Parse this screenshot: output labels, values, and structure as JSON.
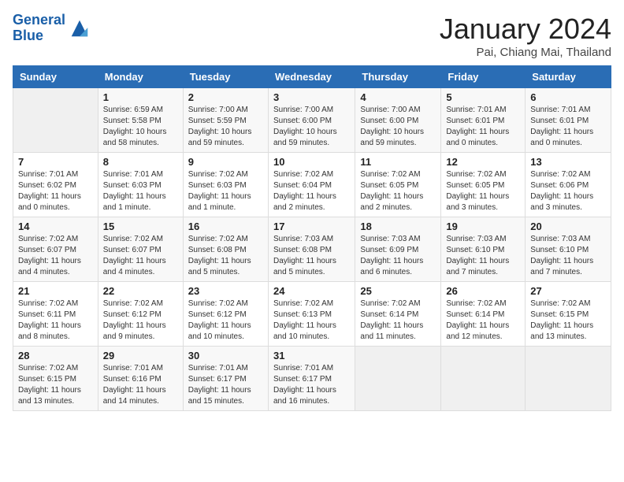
{
  "header": {
    "logo_line1": "General",
    "logo_line2": "Blue",
    "month": "January 2024",
    "location": "Pai, Chiang Mai, Thailand"
  },
  "days_of_week": [
    "Sunday",
    "Monday",
    "Tuesday",
    "Wednesday",
    "Thursday",
    "Friday",
    "Saturday"
  ],
  "weeks": [
    [
      {
        "day": "",
        "info": ""
      },
      {
        "day": "1",
        "info": "Sunrise: 6:59 AM\nSunset: 5:58 PM\nDaylight: 10 hours\nand 58 minutes."
      },
      {
        "day": "2",
        "info": "Sunrise: 7:00 AM\nSunset: 5:59 PM\nDaylight: 10 hours\nand 59 minutes."
      },
      {
        "day": "3",
        "info": "Sunrise: 7:00 AM\nSunset: 6:00 PM\nDaylight: 10 hours\nand 59 minutes."
      },
      {
        "day": "4",
        "info": "Sunrise: 7:00 AM\nSunset: 6:00 PM\nDaylight: 10 hours\nand 59 minutes."
      },
      {
        "day": "5",
        "info": "Sunrise: 7:01 AM\nSunset: 6:01 PM\nDaylight: 11 hours\nand 0 minutes."
      },
      {
        "day": "6",
        "info": "Sunrise: 7:01 AM\nSunset: 6:01 PM\nDaylight: 11 hours\nand 0 minutes."
      }
    ],
    [
      {
        "day": "7",
        "info": "Sunrise: 7:01 AM\nSunset: 6:02 PM\nDaylight: 11 hours\nand 0 minutes."
      },
      {
        "day": "8",
        "info": "Sunrise: 7:01 AM\nSunset: 6:03 PM\nDaylight: 11 hours\nand 1 minute."
      },
      {
        "day": "9",
        "info": "Sunrise: 7:02 AM\nSunset: 6:03 PM\nDaylight: 11 hours\nand 1 minute."
      },
      {
        "day": "10",
        "info": "Sunrise: 7:02 AM\nSunset: 6:04 PM\nDaylight: 11 hours\nand 2 minutes."
      },
      {
        "day": "11",
        "info": "Sunrise: 7:02 AM\nSunset: 6:05 PM\nDaylight: 11 hours\nand 2 minutes."
      },
      {
        "day": "12",
        "info": "Sunrise: 7:02 AM\nSunset: 6:05 PM\nDaylight: 11 hours\nand 3 minutes."
      },
      {
        "day": "13",
        "info": "Sunrise: 7:02 AM\nSunset: 6:06 PM\nDaylight: 11 hours\nand 3 minutes."
      }
    ],
    [
      {
        "day": "14",
        "info": "Sunrise: 7:02 AM\nSunset: 6:07 PM\nDaylight: 11 hours\nand 4 minutes."
      },
      {
        "day": "15",
        "info": "Sunrise: 7:02 AM\nSunset: 6:07 PM\nDaylight: 11 hours\nand 4 minutes."
      },
      {
        "day": "16",
        "info": "Sunrise: 7:02 AM\nSunset: 6:08 PM\nDaylight: 11 hours\nand 5 minutes."
      },
      {
        "day": "17",
        "info": "Sunrise: 7:03 AM\nSunset: 6:08 PM\nDaylight: 11 hours\nand 5 minutes."
      },
      {
        "day": "18",
        "info": "Sunrise: 7:03 AM\nSunset: 6:09 PM\nDaylight: 11 hours\nand 6 minutes."
      },
      {
        "day": "19",
        "info": "Sunrise: 7:03 AM\nSunset: 6:10 PM\nDaylight: 11 hours\nand 7 minutes."
      },
      {
        "day": "20",
        "info": "Sunrise: 7:03 AM\nSunset: 6:10 PM\nDaylight: 11 hours\nand 7 minutes."
      }
    ],
    [
      {
        "day": "21",
        "info": "Sunrise: 7:02 AM\nSunset: 6:11 PM\nDaylight: 11 hours\nand 8 minutes."
      },
      {
        "day": "22",
        "info": "Sunrise: 7:02 AM\nSunset: 6:12 PM\nDaylight: 11 hours\nand 9 minutes."
      },
      {
        "day": "23",
        "info": "Sunrise: 7:02 AM\nSunset: 6:12 PM\nDaylight: 11 hours\nand 10 minutes."
      },
      {
        "day": "24",
        "info": "Sunrise: 7:02 AM\nSunset: 6:13 PM\nDaylight: 11 hours\nand 10 minutes."
      },
      {
        "day": "25",
        "info": "Sunrise: 7:02 AM\nSunset: 6:14 PM\nDaylight: 11 hours\nand 11 minutes."
      },
      {
        "day": "26",
        "info": "Sunrise: 7:02 AM\nSunset: 6:14 PM\nDaylight: 11 hours\nand 12 minutes."
      },
      {
        "day": "27",
        "info": "Sunrise: 7:02 AM\nSunset: 6:15 PM\nDaylight: 11 hours\nand 13 minutes."
      }
    ],
    [
      {
        "day": "28",
        "info": "Sunrise: 7:02 AM\nSunset: 6:15 PM\nDaylight: 11 hours\nand 13 minutes."
      },
      {
        "day": "29",
        "info": "Sunrise: 7:01 AM\nSunset: 6:16 PM\nDaylight: 11 hours\nand 14 minutes."
      },
      {
        "day": "30",
        "info": "Sunrise: 7:01 AM\nSunset: 6:17 PM\nDaylight: 11 hours\nand 15 minutes."
      },
      {
        "day": "31",
        "info": "Sunrise: 7:01 AM\nSunset: 6:17 PM\nDaylight: 11 hours\nand 16 minutes."
      },
      {
        "day": "",
        "info": ""
      },
      {
        "day": "",
        "info": ""
      },
      {
        "day": "",
        "info": ""
      }
    ]
  ]
}
